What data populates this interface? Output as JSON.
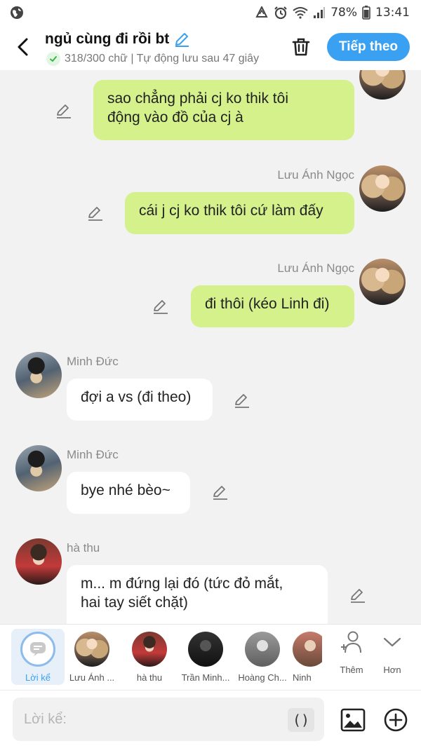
{
  "status_bar": {
    "battery": "78%",
    "time": "13:41"
  },
  "header": {
    "title": "ngủ cùng đi rồi bt",
    "subtitle": "318/300 chữ | Tự động lưu sau 47 giây",
    "next_button": "Tiếp theo"
  },
  "messages": [
    {
      "side": "right",
      "author": "",
      "text": "sao chẳng phải cj ko thik tôi\nđộng vào đồ của cj à"
    },
    {
      "side": "right",
      "author": "Lưu Ánh Ngọc",
      "text": "cái j cj ko thik tôi cứ làm đấy"
    },
    {
      "side": "right",
      "author": "Lưu Ánh Ngọc",
      "text": "đi thôi (kéo Linh đi)"
    },
    {
      "side": "left",
      "author": "Minh Đức",
      "text": "đợi a vs (đi theo)"
    },
    {
      "side": "left",
      "author": "Minh Đức",
      "text": "bye nhé bèo~"
    },
    {
      "side": "left",
      "author": "hà thu",
      "text": "m... m đứng lại đó (tức đỏ mắt,\nhai tay siết chặt)"
    }
  ],
  "characters": [
    {
      "label": "Lời kể",
      "active": true
    },
    {
      "label": "Lưu Ánh Ngọc",
      "short": "Lưu Ánh ..."
    },
    {
      "label": "hà thu",
      "short": "hà thu"
    },
    {
      "label": "Trần Minh...",
      "short": "Trần Minh..."
    },
    {
      "label": "Hoàng Ch...",
      "short": "Hoàng Ch..."
    },
    {
      "label": "Ninh",
      "short": "Ninh"
    }
  ],
  "tools": {
    "add_label": "Thêm",
    "more_label": "Hơn"
  },
  "composer": {
    "placeholder": "Lời kể:",
    "paren_label": "()"
  },
  "colors": {
    "accent": "#3aa1f2",
    "my_bubble": "#d4f18c",
    "other_bubble": "#ffffff",
    "background": "#f2f2f2"
  }
}
